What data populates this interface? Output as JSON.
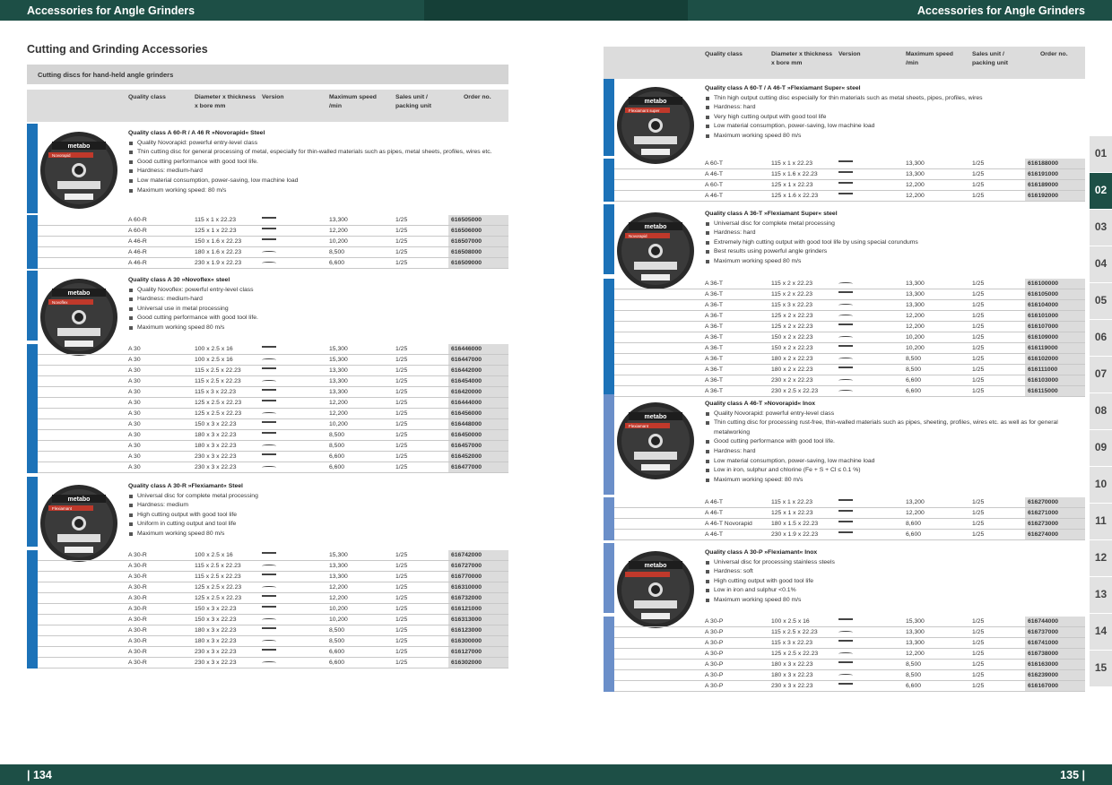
{
  "header": {
    "left_title": "Accessories for Angle Grinders",
    "right_title": "Accessories for Angle Grinders"
  },
  "footer": {
    "left_page": "| 134",
    "right_page": "135 |"
  },
  "section_title": "Cutting and Grinding Accessories",
  "subheading": "Cutting discs for hand-held angle grinders",
  "columns": {
    "quality": "Quality class",
    "diameter": "Diameter x thickness x bore mm",
    "version": "Version",
    "speed": "Maximum speed /min",
    "sales": "Sales unit / packing unit",
    "order": "Order no."
  },
  "tabs": [
    "01",
    "02",
    "03",
    "04",
    "05",
    "06",
    "07",
    "08",
    "09",
    "10",
    "11",
    "12",
    "13",
    "14",
    "15"
  ],
  "active_tab": "02",
  "left_groups": [
    {
      "title": "Quality class A 60-R / A 46 R »Novorapid« Steel",
      "bullets": [
        "Quality Novorapid: powerful entry-level class",
        "Thin cutting disc for general processing of metal, especially for thin-walled materials such as pipes, metal sheets, profiles, wires etc.",
        "Good cutting performance with good tool life.",
        "Hardness: medium-hard",
        "Low material consumption, power-saving, low machine load",
        "Maximum working speed: 80 m/s"
      ],
      "rows": [
        [
          "A 60-R",
          "115 x 1 x 22.23",
          "s",
          "13,300",
          "1/25",
          "616505000"
        ],
        [
          "A 60-R",
          "125 x 1 x 22.23",
          "s",
          "12,200",
          "1/25",
          "616506000"
        ],
        [
          "A 46-R",
          "150 x 1.6 x 22.23",
          "s",
          "10,200",
          "1/25",
          "616507000"
        ],
        [
          "A 46-R",
          "180 x 1.6 x 22.23",
          "c",
          "8,500",
          "1/25",
          "616508000"
        ],
        [
          "A 46-R",
          "230 x 1.9 x 22.23",
          "c",
          "6,600",
          "1/25",
          "616509000"
        ]
      ]
    },
    {
      "title": "Quality class A 30 »Novoflex« steel",
      "bullets": [
        "Quality Novoflex: powerful entry-level class",
        "Hardness: medium-hard",
        "Universal use in metal processing",
        "Good cutting performance with good tool life.",
        "Maximum working speed 80 m/s"
      ],
      "rows": [
        [
          "A 30",
          "100 x 2.5 x 16",
          "s",
          "15,300",
          "1/25",
          "616446000"
        ],
        [
          "A 30",
          "100 x 2.5 x 16",
          "c",
          "15,300",
          "1/25",
          "616447000"
        ],
        [
          "A 30",
          "115 x 2.5 x 22.23",
          "s",
          "13,300",
          "1/25",
          "616442000"
        ],
        [
          "A 30",
          "115 x 2.5 x 22.23",
          "c",
          "13,300",
          "1/25",
          "616454000"
        ],
        [
          "A 30",
          "115 x 3 x 22.23",
          "s",
          "13,300",
          "1/25",
          "616420000"
        ],
        [
          "A 30",
          "125 x 2.5 x 22.23",
          "s",
          "12,200",
          "1/25",
          "616444000"
        ],
        [
          "A 30",
          "125 x 2.5 x 22.23",
          "c",
          "12,200",
          "1/25",
          "616456000"
        ],
        [
          "A 30",
          "150 x 3 x 22.23",
          "s",
          "10,200",
          "1/25",
          "616448000"
        ],
        [
          "A 30",
          "180 x 3 x 22.23",
          "s",
          "8,500",
          "1/25",
          "616450000"
        ],
        [
          "A 30",
          "180 x 3 x 22.23",
          "c",
          "8,500",
          "1/25",
          "616457000"
        ],
        [
          "A 30",
          "230 x 3 x 22.23",
          "s",
          "6,600",
          "1/25",
          "616452000"
        ],
        [
          "A 30",
          "230 x 3 x 22.23",
          "c",
          "6,600",
          "1/25",
          "616477000"
        ]
      ]
    },
    {
      "title": "Quality class A 30-R »Flexiamant« Steel",
      "bullets": [
        "Universal disc for complete metal processing",
        "Hardness: medium",
        "High cutting output with good tool life",
        "Uniform in cutting output and tool life",
        "Maximum working speed 80 m/s"
      ],
      "rows": [
        [
          "A 30-R",
          "100 x 2.5 x 16",
          "s",
          "15,300",
          "1/25",
          "616742000"
        ],
        [
          "A 30-R",
          "115 x 2.5 x 22.23",
          "c",
          "13,300",
          "1/25",
          "616727000"
        ],
        [
          "A 30-R",
          "115 x 2.5 x 22.23",
          "s",
          "13,300",
          "1/25",
          "616770000"
        ],
        [
          "A 30-R",
          "125 x 2.5 x 22.23",
          "c",
          "12,200",
          "1/25",
          "616310000"
        ],
        [
          "A 30-R",
          "125 x 2.5 x 22.23",
          "s",
          "12,200",
          "1/25",
          "616732000"
        ],
        [
          "A 30-R",
          "150 x 3 x 22.23",
          "s",
          "10,200",
          "1/25",
          "616121000"
        ],
        [
          "A 30-R",
          "150 x 3 x 22.23",
          "c",
          "10,200",
          "1/25",
          "616313000"
        ],
        [
          "A 30-R",
          "180 x 3 x 22.23",
          "s",
          "8,500",
          "1/25",
          "616123000"
        ],
        [
          "A 30-R",
          "180 x 3 x 22.23",
          "c",
          "8,500",
          "1/25",
          "616300000"
        ],
        [
          "A 30-R",
          "230 x 3 x 22.23",
          "s",
          "6,600",
          "1/25",
          "616127000"
        ],
        [
          "A 30-R",
          "230 x 3 x 22.23",
          "c",
          "6,600",
          "1/25",
          "616302000"
        ]
      ]
    }
  ],
  "right_groups": [
    {
      "title": "Quality class A 60-T / A 46-T »Flexiamant Super« steel",
      "bullets": [
        "Thin high output cutting disc especially for thin materials such as metal sheets, pipes, profiles, wires",
        "Hardness: hard",
        "Very high cutting output with good tool life",
        "Low material consumption, power-saving, low machine load",
        "Maximum working speed 80 m/s"
      ],
      "rows": [
        [
          "A 60-T",
          "115 x 1 x 22.23",
          "s",
          "13,300",
          "1/25",
          "616188000"
        ],
        [
          "A 46-T",
          "115 x 1.6 x 22.23",
          "s",
          "13,300",
          "1/25",
          "616191000"
        ],
        [
          "A 60-T",
          "125 x 1 x 22.23",
          "s",
          "12,200",
          "1/25",
          "616189000"
        ],
        [
          "A 46-T",
          "125 x 1.6 x 22.23",
          "s",
          "12,200",
          "1/25",
          "616192000"
        ]
      ]
    },
    {
      "title": "Quality class A 36-T »Flexiamant Super« steel",
      "bullets": [
        "Universal disc for complete metal processing",
        "Hardness: hard",
        "Extremely high cutting output with good tool life by using special corundums",
        "Best results using powerful angle grinders",
        "Maximum working speed 80 m/s"
      ],
      "rows": [
        [
          "A 36-T",
          "115 x 2 x 22.23",
          "c",
          "13,300",
          "1/25",
          "616100000"
        ],
        [
          "A 36-T",
          "115 x 2 x 22.23",
          "s",
          "13,300",
          "1/25",
          "616105000"
        ],
        [
          "A 36-T",
          "115 x 3 x 22.23",
          "c",
          "13,300",
          "1/25",
          "616104000"
        ],
        [
          "A 36-T",
          "125 x 2 x 22.23",
          "c",
          "12,200",
          "1/25",
          "616101000"
        ],
        [
          "A 36-T",
          "125 x 2 x 22.23",
          "s",
          "12,200",
          "1/25",
          "616107000"
        ],
        [
          "A 36-T",
          "150 x 2 x 22.23",
          "c",
          "10,200",
          "1/25",
          "616109000"
        ],
        [
          "A 36-T",
          "150 x 2 x 22.23",
          "s",
          "10,200",
          "1/25",
          "616119000"
        ],
        [
          "A 36-T",
          "180 x 2 x 22.23",
          "c",
          "8,500",
          "1/25",
          "616102000"
        ],
        [
          "A 36-T",
          "180 x 2 x 22.23",
          "s",
          "8,500",
          "1/25",
          "616111000"
        ],
        [
          "A 36-T",
          "230 x 2 x 22.23",
          "c",
          "6,600",
          "1/25",
          "616103000"
        ],
        [
          "A 36-T",
          "230 x 2.5 x 22.23",
          "c",
          "6,600",
          "1/25",
          "616115000"
        ]
      ]
    },
    {
      "title": "Quality class A 46-T »Novorapid« Inox",
      "bullets": [
        "Quality Novorapid: powerful entry-level class",
        "Thin cutting disc for processing rust-free, thin-walled materials such as pipes, sheeting, profiles, wires etc. as well as for general metalworking",
        "Good cutting performance with good tool life.",
        "Hardness: hard",
        "Low material consumption, power-saving, low machine load",
        "Low in iron, sulphur and chlorine (Fe + S + Cl ≤ 0.1 %)",
        "Maximum working speed: 80 m/s"
      ],
      "rows": [
        [
          "A 46-T",
          "115 x 1 x 22.23",
          "s",
          "13,200",
          "1/25",
          "616270000"
        ],
        [
          "A 46-T",
          "125 x 1 x 22.23",
          "s",
          "12,200",
          "1/25",
          "616271000"
        ],
        [
          "A 46-T Novorapid",
          "180 x 1.5 x 22.23",
          "s",
          "8,600",
          "1/25",
          "616273000"
        ],
        [
          "A 46-T",
          "230 x 1.9 x 22.23",
          "s",
          "6,600",
          "1/25",
          "616274000"
        ]
      ]
    },
    {
      "title": "Quality class A 30-P »Flexiamant« Inox",
      "bullets": [
        "Universal disc for processing stainless steels",
        "Hardness: soft",
        "High cutting output with good tool life",
        "Low in iron and sulphur <0.1%",
        "Maximum working speed 80 m/s"
      ],
      "rows": [
        [
          "A 30-P",
          "100 x 2.5 x 16",
          "s",
          "15,300",
          "1/25",
          "616744000"
        ],
        [
          "A 30-P",
          "115 x 2.5 x 22.23",
          "c",
          "13,300",
          "1/25",
          "616737000"
        ],
        [
          "A 30-P",
          "115 x 3 x 22.23",
          "s",
          "13,300",
          "1/25",
          "616741000"
        ],
        [
          "A 30-P",
          "125 x 2.5 x 22.23",
          "c",
          "12,200",
          "1/25",
          "616738000"
        ],
        [
          "A 30-P",
          "180 x 3 x 22.23",
          "s",
          "8,500",
          "1/25",
          "616163000"
        ],
        [
          "A 30-P",
          "180 x 3 x 22.23",
          "c",
          "8,500",
          "1/25",
          "616239000"
        ],
        [
          "A 30-P",
          "230 x 3 x 22.23",
          "s",
          "6,600",
          "1/25",
          "616167000"
        ]
      ]
    }
  ],
  "disc": {
    "brand": "metabo",
    "variants": [
      "Novorapid",
      "Novoflex",
      "Flexiamant",
      "Flexiamant super",
      "Novorapid",
      "Flexiamant"
    ]
  },
  "colors": {
    "header": "#1d4f46",
    "strip_blue": "#1c72b8",
    "strip_light": "#6b8fc9"
  }
}
